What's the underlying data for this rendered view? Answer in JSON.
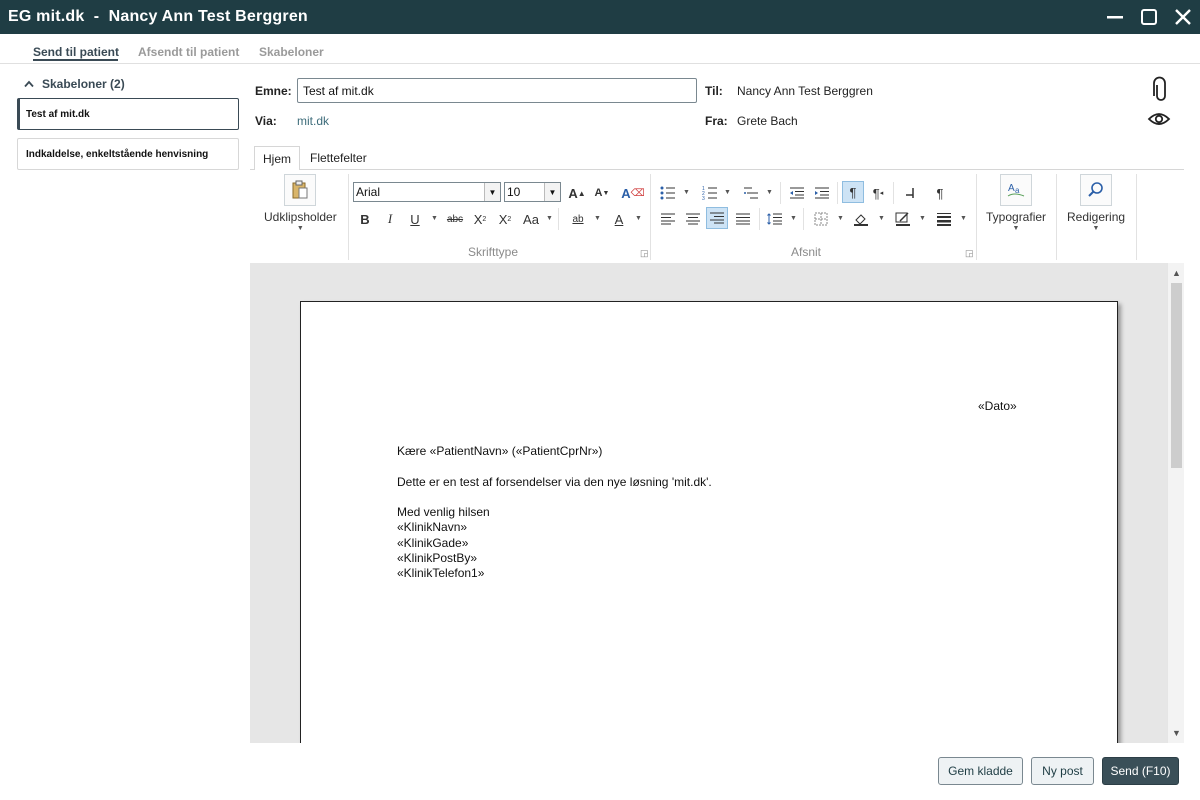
{
  "window": {
    "title": "EG mit.dk  -  Nancy Ann Test Berggren"
  },
  "topnav": {
    "items": [
      "Send til patient",
      "Afsendt til patient",
      "Skabeloner"
    ]
  },
  "templates": {
    "header": "Skabeloner (2)",
    "items": [
      "Test af mit.dk",
      "Indkaldelse, enkeltstående henvisning"
    ]
  },
  "form": {
    "subject_label": "Emne:",
    "subject_value": "Test af mit.dk",
    "via_label": "Via:",
    "via_value": "mit.dk",
    "to_label": "Til:",
    "to_value": "Nancy Ann Test Berggren",
    "from_label": "Fra:",
    "from_value": "Grete Bach"
  },
  "ribbon": {
    "tabs": [
      "Hjem",
      "Flettefelter"
    ],
    "clipboard_label": "Udklipsholder",
    "font_name": "Arial",
    "font_size": "10",
    "font_group_label": "Skrifttype",
    "paragraph_group_label": "Afsnit",
    "styles_label": "Typografier",
    "editing_label": "Redigering"
  },
  "document": {
    "date_field": "«Dato»",
    "greeting": "Kære «PatientNavn» («PatientCprNr»)",
    "body": "Dette er en test af forsendelser via den nye løsning 'mit.dk'.",
    "closing": "Med venlig hilsen",
    "clinic_name": "«KlinikNavn»",
    "clinic_street": "«KlinikGade»",
    "clinic_postal": "«KlinikPostBy»",
    "clinic_phone": "«KlinikTelefon1»"
  },
  "buttons": {
    "save_draft": "Gem kladde",
    "new_post": "Ny post",
    "send": "Send (F10)"
  },
  "colors": {
    "titlebar": "#1f3d44",
    "accent": "#3a4a55"
  }
}
